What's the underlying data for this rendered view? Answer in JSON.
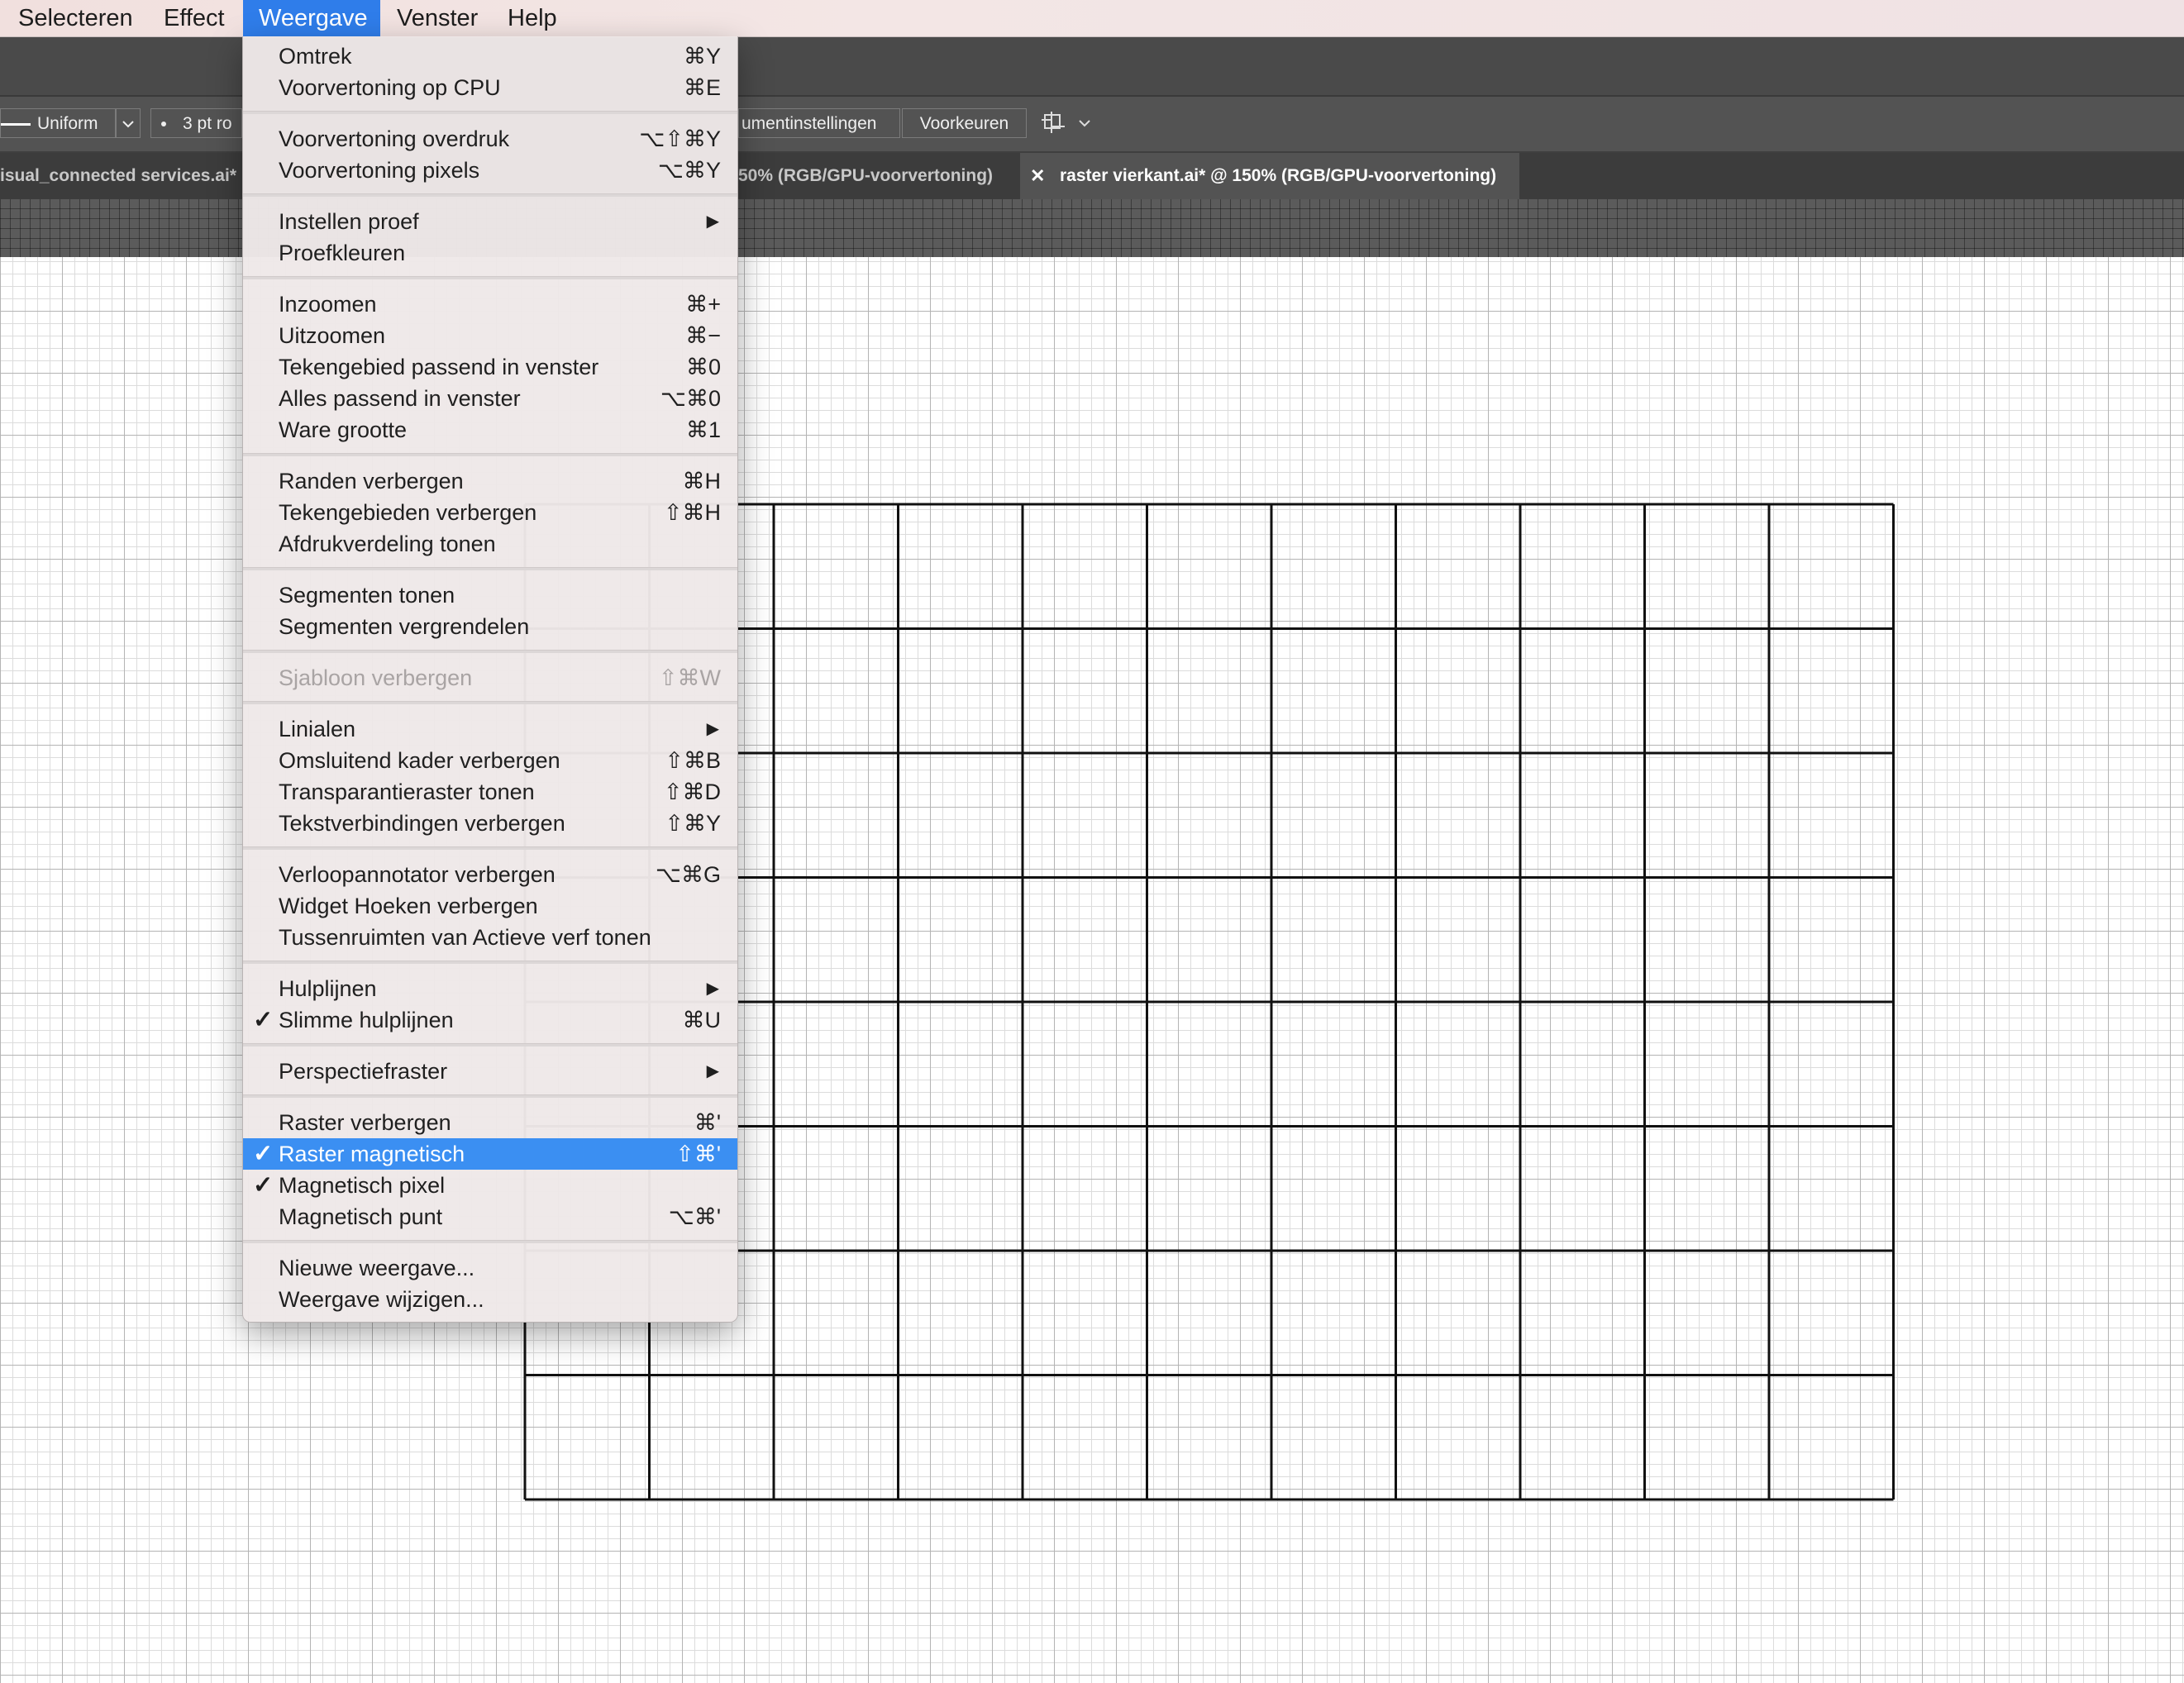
{
  "menubar": {
    "items": [
      "Selecteren",
      "Effect",
      "Weergave",
      "Venster",
      "Help"
    ],
    "active": "Weergave"
  },
  "control_bar": {
    "stroke_profile": "Uniform",
    "brush_size": "3 pt ro",
    "document_settings": "umentinstellingen",
    "preferences": "Voorkeuren"
  },
  "tabs": [
    {
      "label": "isual_connected services.ai*",
      "active": false
    },
    {
      "label": "50% (RGB/GPU-voorvertoning)",
      "active": false
    },
    {
      "label": "raster vierkant.ai* @ 150% (RGB/GPU-voorvertoning)",
      "active": true
    }
  ],
  "menu": {
    "title": "Weergave",
    "items": [
      {
        "label": "Omtrek",
        "shortcut": "⌘Y"
      },
      {
        "label": "Voorvertoning op CPU",
        "shortcut": "⌘E"
      },
      {
        "label": "Voorvertoning overdruk",
        "shortcut": "⌥⇧⌘Y"
      },
      {
        "label": "Voorvertoning pixels",
        "shortcut": "⌥⌘Y"
      },
      {
        "label": "Instellen proef",
        "submenu": "▶"
      },
      {
        "label": "Proefkleuren"
      },
      {
        "label": "Inzoomen",
        "shortcut": "⌘+"
      },
      {
        "label": "Uitzoomen",
        "shortcut": "⌘−"
      },
      {
        "label": "Tekengebied passend in venster",
        "shortcut": "⌘0"
      },
      {
        "label": "Alles passend in venster",
        "shortcut": "⌥⌘0"
      },
      {
        "label": "Ware grootte",
        "shortcut": "⌘1"
      },
      {
        "label": "Randen verbergen",
        "shortcut": "⌘H"
      },
      {
        "label": "Tekengebieden verbergen",
        "shortcut": "⇧⌘H"
      },
      {
        "label": "Afdrukverdeling tonen"
      },
      {
        "label": "Segmenten tonen"
      },
      {
        "label": "Segmenten vergrendelen"
      },
      {
        "label": "Sjabloon verbergen",
        "shortcut": "⇧⌘W",
        "disabled": true
      },
      {
        "label": "Linialen",
        "submenu": "▶"
      },
      {
        "label": "Omsluitend kader verbergen",
        "shortcut": "⇧⌘B"
      },
      {
        "label": "Transparantieraster tonen",
        "shortcut": "⇧⌘D"
      },
      {
        "label": "Tekstverbindingen verbergen",
        "shortcut": "⇧⌘Y"
      },
      {
        "label": "Verloopannotator verbergen",
        "shortcut": "⌥⌘G"
      },
      {
        "label": "Widget Hoeken verbergen"
      },
      {
        "label": "Tussenruimten van Actieve verf tonen"
      },
      {
        "label": "Hulplijnen",
        "submenu": "▶"
      },
      {
        "label": "Slimme hulplijnen",
        "shortcut": "⌘U",
        "check": "✓"
      },
      {
        "label": "Perspectiefraster",
        "submenu": "▶"
      },
      {
        "label": "Raster verbergen",
        "shortcut": "⌘'"
      },
      {
        "label": "Raster magnetisch",
        "shortcut": "⇧⌘'",
        "check": "✓",
        "selected": true
      },
      {
        "label": "Magnetisch pixel",
        "check": "✓"
      },
      {
        "label": "Magnetisch punt",
        "shortcut": "⌥⌘'"
      },
      {
        "label": "Nieuwe weergave..."
      },
      {
        "label": "Weergave wijzigen..."
      }
    ]
  },
  "colors": {
    "menu_highlight": "#3b8ff2",
    "menubar_active": "#2f7dea",
    "app_chrome": "#535353",
    "artwork_stroke": "#111111"
  }
}
